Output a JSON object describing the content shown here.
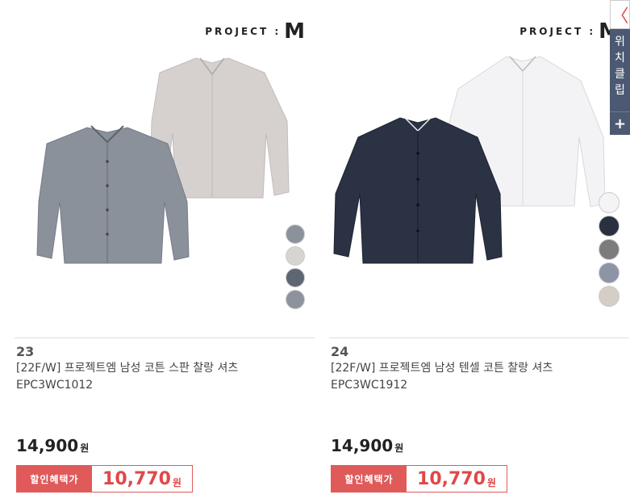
{
  "products": [
    {
      "brand_text": "PROJECT :",
      "brand_mark": "M",
      "rank": "23",
      "title": "[22F/W] 프로젝트엠 남성 코튼 스판 찰랑 셔츠 EPC3WC1012",
      "price": "14,900",
      "price_unit": "원",
      "sale_label": "할인혜택가",
      "sale_price": "10,770",
      "sale_unit": "원",
      "swatches": [
        "#8c929c",
        "#d8d4d2",
        "#5e6674",
        "#8e929c"
      ]
    },
    {
      "brand_text": "PROJECT :",
      "brand_mark": "M",
      "rank": "24",
      "title": "[22F/W] 프로젝트엠 남성 텐셀 코튼 찰랑 셔츠 EPC3WC1912",
      "price": "14,900",
      "price_unit": "원",
      "sale_label": "할인혜택가",
      "sale_price": "10,770",
      "sale_unit": "원",
      "swatches": [
        "#f4f4f6",
        "#2a3040",
        "#7c7c7c",
        "#8d94a6",
        "#d4cec6"
      ]
    }
  ],
  "side_panel": {
    "close_glyph": "〈",
    "notice_text": "위치클립",
    "plus_glyph": "+"
  }
}
